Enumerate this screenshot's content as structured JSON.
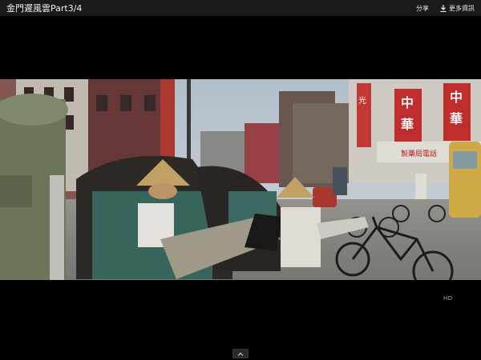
{
  "window": {
    "title": "金門遲風雲Part3/4"
  },
  "toolbar": {
    "share_label": "分享",
    "more_info_label": "更多資訊"
  },
  "video": {
    "scene_signs": [
      "中",
      "華",
      "中",
      "華",
      "光"
    ],
    "shop_sign": "製藥局電話"
  },
  "watermark": {
    "text": "HD"
  },
  "icons": {
    "more_info": "download-arrow-icon",
    "expand": "chevron-up-icon"
  }
}
